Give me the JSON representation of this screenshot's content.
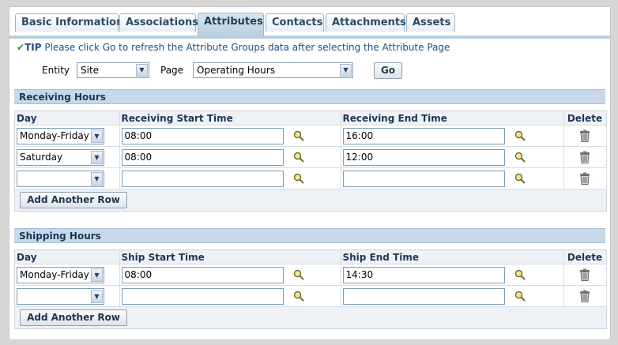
{
  "tabs": [
    {
      "label": "Basic Information",
      "active": false
    },
    {
      "label": "Associations",
      "active": false
    },
    {
      "label": "Attributes",
      "active": true
    },
    {
      "label": "Contacts",
      "active": false
    },
    {
      "label": "Attachments",
      "active": false
    },
    {
      "label": "Assets",
      "active": false
    }
  ],
  "tip": {
    "label": "TIP",
    "text": "Please click Go to refresh the Attribute Groups data after selecting the Attribute Page"
  },
  "filters": {
    "entity_label": "Entity",
    "entity_value": "Site",
    "page_label": "Page",
    "page_value": "Operating Hours",
    "go_label": "Go"
  },
  "receiving": {
    "title": "Receiving Hours",
    "columns": [
      "Day",
      "Receiving Start Time",
      "Receiving End Time",
      "Delete"
    ],
    "rows": [
      {
        "day": "Monday-Friday",
        "start": "08:00",
        "end": "16:00"
      },
      {
        "day": "Saturday",
        "start": "08:00",
        "end": "12:00"
      },
      {
        "day": "",
        "start": "",
        "end": ""
      }
    ],
    "add_label": "Add Another Row"
  },
  "shipping": {
    "title": "Shipping Hours",
    "columns": [
      "Day",
      "Ship Start Time",
      "Ship End Time",
      "Delete"
    ],
    "rows": [
      {
        "day": "Monday-Friday",
        "start": "08:00",
        "end": "14:30"
      },
      {
        "day": "",
        "start": "",
        "end": ""
      }
    ],
    "add_label": "Add Another Row"
  },
  "icons": {
    "lookup": "magnifier-icon",
    "delete": "trash-icon",
    "dropdown": "chevron-down-icon",
    "tip": "check-icon"
  },
  "colors": {
    "section_header": "#c7d8e8",
    "tab_active": "#b9cfe0",
    "tip_text": "#1f4f80"
  }
}
